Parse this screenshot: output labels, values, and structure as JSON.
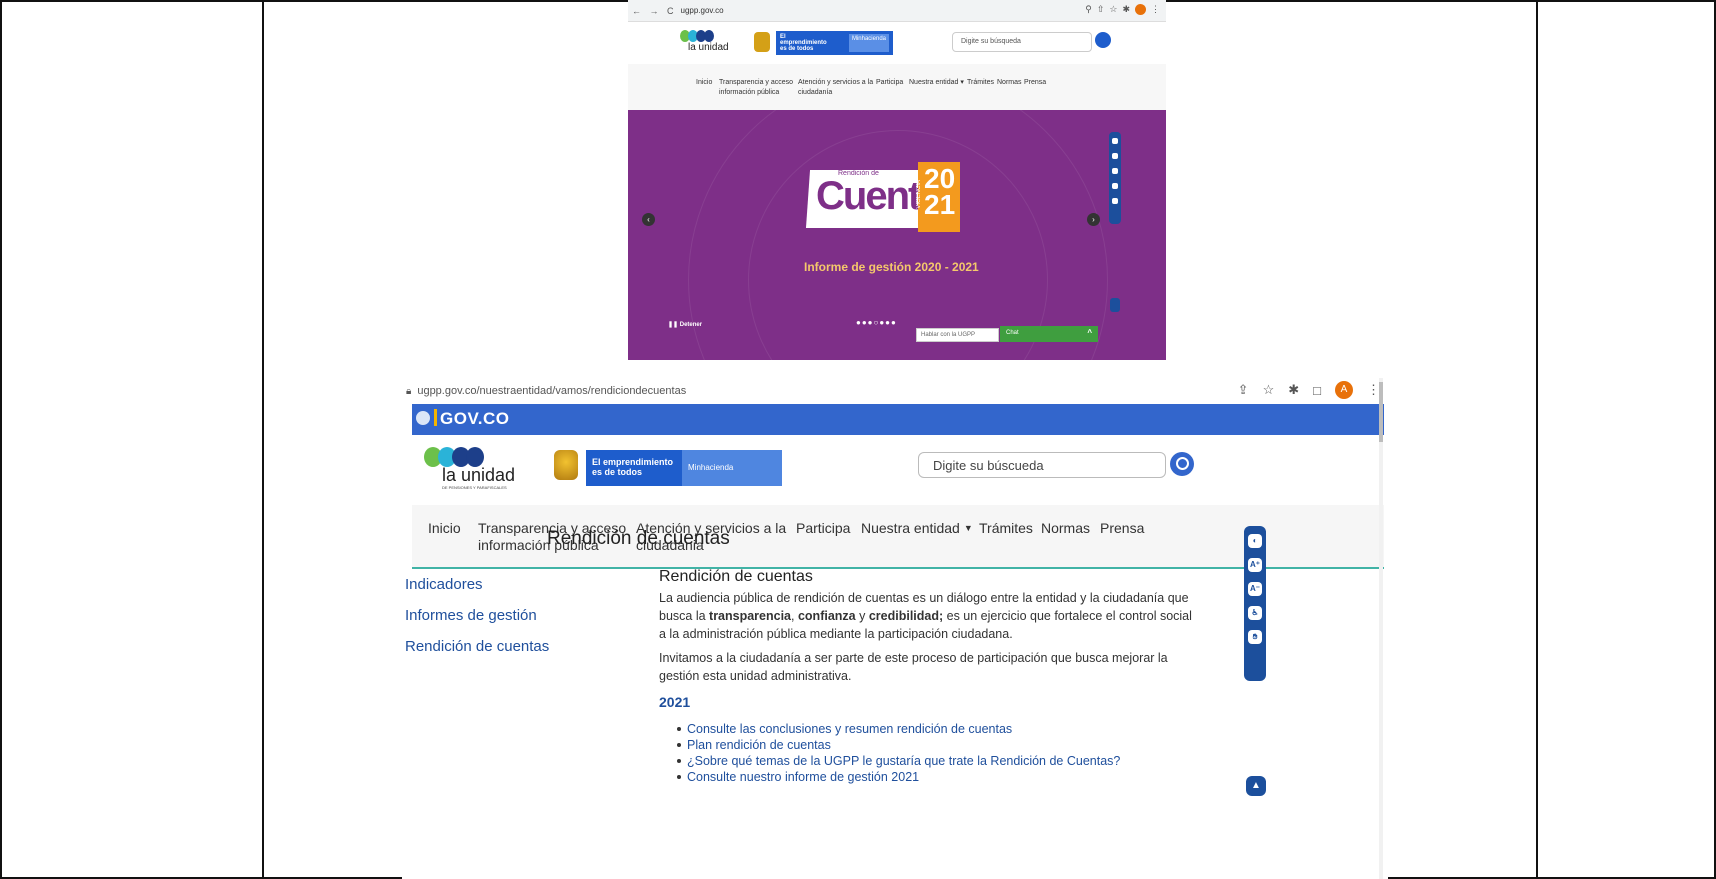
{
  "top_screenshot": {
    "nav_controls": "← → C",
    "url": "ugpp.gov.co",
    "logo_text": "la unidad",
    "banner_main": "El emprendimiento es de todos",
    "banner_side": "Minhacienda",
    "search_placeholder": "Digite su búsqueda",
    "menu": {
      "inicio": "Inicio",
      "transparencia_1": "Transparencia y acceso",
      "transparencia_2": "información pública",
      "atencion_1": "Atención y servicios a la",
      "atencion_2": "ciudadanía",
      "participa": "Participa",
      "nuestra_entidad": "Nuestra entidad",
      "tramites": "Trámites",
      "normas": "Normas",
      "prensa": "Prensa"
    },
    "hero": {
      "small_label": "Rendición de",
      "big_word": "Cuentas",
      "year_top": "20",
      "year_bottom": "21",
      "vigencia": "VIGENCIA",
      "informe": "Informe de gestión 2020 - 2021",
      "detener": "Detener",
      "dots": "●●●○●●●"
    },
    "hablar": "Hablar con la UGPP",
    "chat": "Chat"
  },
  "bottom_screenshot": {
    "url": "ugpp.gov.co/nuestraentidad/vamos/rendiciondecuentas",
    "avatar_letter": "A",
    "gov_logo": "GOV.CO",
    "logo_text": "la unidad",
    "logo_sub": "DE PENSIONES Y PARAFISCALES",
    "banner_main": "El emprendimiento es de todos",
    "banner_side": "Minhacienda",
    "search_placeholder": "Digite su búscueda",
    "menu": {
      "inicio": "Inicio",
      "transparencia_1": "Transparencia y acceso",
      "transparencia_2": "información pública",
      "atencion_1": "Atención y servicios a la",
      "atencion_2": "ciudadania",
      "participa": "Participa",
      "nuestra_entidad": "Nuestra entidad",
      "tramites": "Trámites",
      "normas": "Normas",
      "prensa": "Prensa"
    },
    "page_title": "Rendición de cuentas",
    "sidebar": [
      "Indicadores",
      "Informes de gestión",
      "Rendición de cuentas"
    ],
    "content": {
      "heading": "Rendición de cuentas",
      "p1_a": "La audiencia pública de rendición de cuentas es un diálogo entre la entidad y la ciudadanía que busca la ",
      "p1_b1": "transparencia",
      "p1_sep1": ", ",
      "p1_b2": "confianza",
      "p1_sep2": " y ",
      "p1_b3": "credibilidad;",
      "p1_c": " es un ejercicio que fortalece el control social a la administración pública mediante la participación ciudadana.",
      "p2": "Invitamos a la ciudadanía a ser parte de este proceso de participación que busca mejorar la gestión esta unidad administrativa.",
      "year": "2021",
      "links": [
        "Consulte las conclusiones y resumen rendición de cuentas",
        "Plan rendición de cuentas",
        "¿Sobre qué temas de la UGPP le gustaría que trate la Rendición de Cuentas?",
        "Consulte nuestro informe de gestión 2021"
      ]
    }
  },
  "colors": {
    "gov_blue": "#3366cc",
    "hero_purple": "#7e2f88",
    "accent_teal": "#41b3a6",
    "link_blue": "#1f4f9c"
  }
}
